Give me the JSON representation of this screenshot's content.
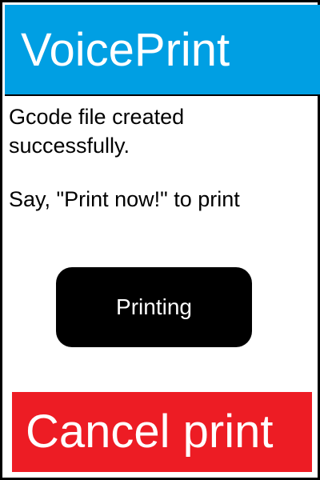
{
  "app": {
    "title": "VoicePrint"
  },
  "message": {
    "line1": "Gcode file created",
    "line2": "successfully.",
    "line3": "Say, \"Print now!\" to print"
  },
  "status_button": {
    "label": "Printing"
  },
  "cancel_button": {
    "label": "Cancel print"
  },
  "colors": {
    "header": "#009fe3",
    "status_button": "#000000",
    "cancel_button": "#ed1c24",
    "text_light": "#ffffff",
    "text_dark": "#000000"
  }
}
